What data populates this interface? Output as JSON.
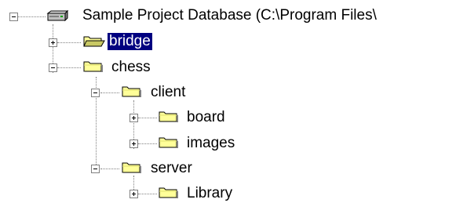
{
  "tree": {
    "root": {
      "label": "Sample Project Database (C:\\Program Files\\",
      "icon": "drive-icon",
      "expanded": true
    },
    "nodes": [
      {
        "label": "bridge",
        "icon": "folder-open-icon",
        "expanded": false,
        "selected": true
      },
      {
        "label": "chess",
        "icon": "folder-icon",
        "expanded": true,
        "selected": false
      },
      {
        "label": "client",
        "icon": "folder-icon",
        "expanded": true,
        "selected": false
      },
      {
        "label": "board",
        "icon": "folder-icon",
        "expanded": false,
        "selected": false
      },
      {
        "label": "images",
        "icon": "folder-icon",
        "expanded": false,
        "selected": false
      },
      {
        "label": "server",
        "icon": "folder-icon",
        "expanded": true,
        "selected": false
      },
      {
        "label": "Library",
        "icon": "folder-icon",
        "expanded": false,
        "selected": false
      }
    ]
  },
  "colors": {
    "selection_bg": "#000080",
    "selection_fg": "#ffffff",
    "folder_fill": "#ffff99",
    "tree_lines": "#808080"
  }
}
